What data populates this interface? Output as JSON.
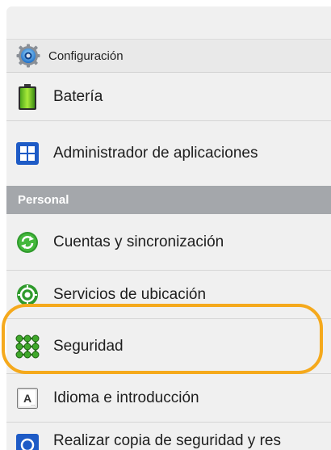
{
  "header": {
    "title": "Configuración",
    "icon": "settings-gear-icon"
  },
  "items_top": [
    {
      "label": "Batería",
      "icon": "battery-icon"
    },
    {
      "label": "Administrador de aplicaciones",
      "icon": "app-manager-icon"
    }
  ],
  "section": {
    "label": "Personal"
  },
  "items_personal": [
    {
      "label": "Cuentas y sincronización",
      "icon": "sync-icon"
    },
    {
      "label": "Servicios de ubicación",
      "icon": "location-icon"
    },
    {
      "label": "Seguridad",
      "icon": "security-grid-icon"
    },
    {
      "label": "Idioma e introducción",
      "icon": "language-icon"
    },
    {
      "label": "Realizar copia de seguridad y res",
      "icon": "backup-icon"
    }
  ],
  "colors": {
    "highlight": "#f5a91c",
    "section_bg": "#a4a7ab",
    "panel_bg": "#f0f0f0"
  }
}
